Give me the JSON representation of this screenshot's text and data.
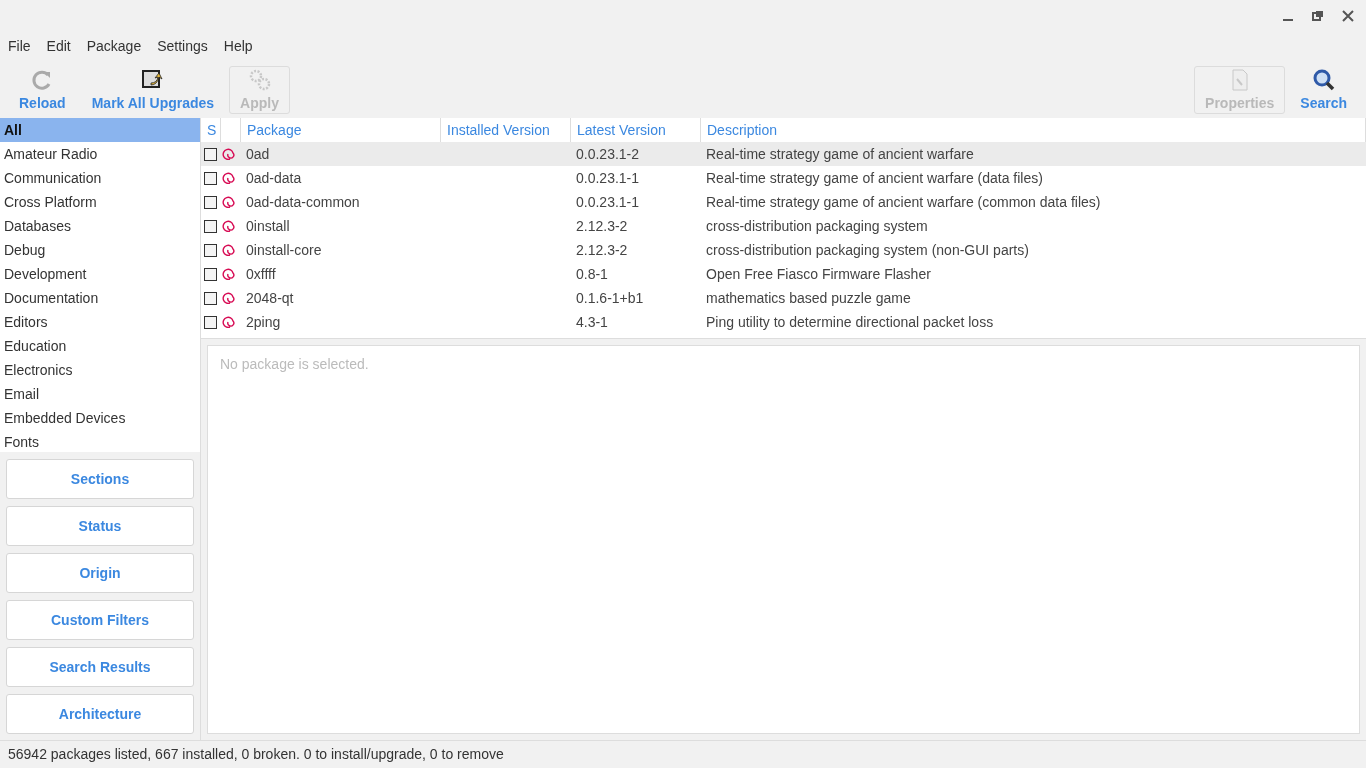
{
  "menu": [
    "File",
    "Edit",
    "Package",
    "Settings",
    "Help"
  ],
  "toolbar_left": [
    {
      "label": "Reload",
      "kind": "reload",
      "disabled": false
    },
    {
      "label": "Mark All Upgrades",
      "kind": "upgrade",
      "disabled": false
    },
    {
      "label": "Apply",
      "kind": "apply",
      "disabled": true
    }
  ],
  "toolbar_right": [
    {
      "label": "Properties",
      "kind": "properties",
      "disabled": true
    },
    {
      "label": "Search",
      "kind": "search",
      "disabled": false
    }
  ],
  "sidebar": {
    "items": [
      {
        "label": "All",
        "selected": true
      },
      {
        "label": "Amateur Radio",
        "selected": false
      },
      {
        "label": "Communication",
        "selected": false
      },
      {
        "label": "Cross Platform",
        "selected": false
      },
      {
        "label": "Databases",
        "selected": false
      },
      {
        "label": "Debug",
        "selected": false
      },
      {
        "label": "Development",
        "selected": false
      },
      {
        "label": "Documentation",
        "selected": false
      },
      {
        "label": "Editors",
        "selected": false
      },
      {
        "label": "Education",
        "selected": false
      },
      {
        "label": "Electronics",
        "selected": false
      },
      {
        "label": "Email",
        "selected": false
      },
      {
        "label": "Embedded Devices",
        "selected": false
      },
      {
        "label": "Fonts",
        "selected": false
      }
    ],
    "filter_buttons": [
      "Sections",
      "Status",
      "Origin",
      "Custom Filters",
      "Search Results",
      "Architecture"
    ]
  },
  "table": {
    "columns": [
      "S",
      "Package",
      "Installed Version",
      "Latest Version",
      "Description"
    ],
    "rows": [
      {
        "checked": false,
        "selected": true,
        "package": "0ad",
        "latest": "0.0.23.1-2",
        "description": "Real-time strategy game of ancient warfare"
      },
      {
        "checked": false,
        "selected": false,
        "package": "0ad-data",
        "latest": "0.0.23.1-1",
        "description": "Real-time strategy game of ancient warfare (data files)"
      },
      {
        "checked": false,
        "selected": false,
        "package": "0ad-data-common",
        "latest": "0.0.23.1-1",
        "description": "Real-time strategy game of ancient warfare (common data files)"
      },
      {
        "checked": false,
        "selected": false,
        "package": "0install",
        "latest": "2.12.3-2",
        "description": "cross-distribution packaging system"
      },
      {
        "checked": false,
        "selected": false,
        "package": "0install-core",
        "latest": "2.12.3-2",
        "description": "cross-distribution packaging system (non-GUI parts)"
      },
      {
        "checked": false,
        "selected": false,
        "package": "0xffff",
        "latest": "0.8-1",
        "description": "Open Free Fiasco Firmware Flasher"
      },
      {
        "checked": false,
        "selected": false,
        "package": "2048-qt",
        "latest": "0.1.6-1+b1",
        "description": "mathematics based puzzle game"
      },
      {
        "checked": false,
        "selected": false,
        "package": "2ping",
        "latest": "4.3-1",
        "description": "Ping utility to determine directional packet loss"
      }
    ]
  },
  "details": {
    "placeholder": "No package is selected."
  },
  "status_bar": "56942 packages listed, 667 installed, 0 broken. 0 to install/upgrade, 0 to remove"
}
